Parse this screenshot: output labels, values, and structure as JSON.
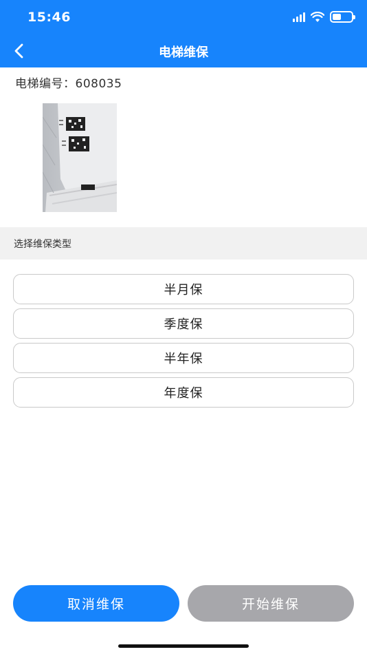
{
  "status_bar": {
    "time": "15:46",
    "icons": [
      "signal-icon",
      "wifi-icon",
      "battery-icon"
    ]
  },
  "nav": {
    "back_icon": "chevron-left-icon",
    "title": "电梯维保"
  },
  "elevator": {
    "number_text": "电梯编号：608035"
  },
  "section": {
    "label": "选择维保类型"
  },
  "options": [
    {
      "label": "半月保"
    },
    {
      "label": "季度保"
    },
    {
      "label": "半年保"
    },
    {
      "label": "年度保"
    }
  ],
  "buttons": {
    "cancel_label": "取消维保",
    "start_label": "开始维保"
  },
  "colors": {
    "primary": "#1784fc",
    "disabled": "#a7a7ab",
    "section_bg": "#f1f1f1"
  }
}
